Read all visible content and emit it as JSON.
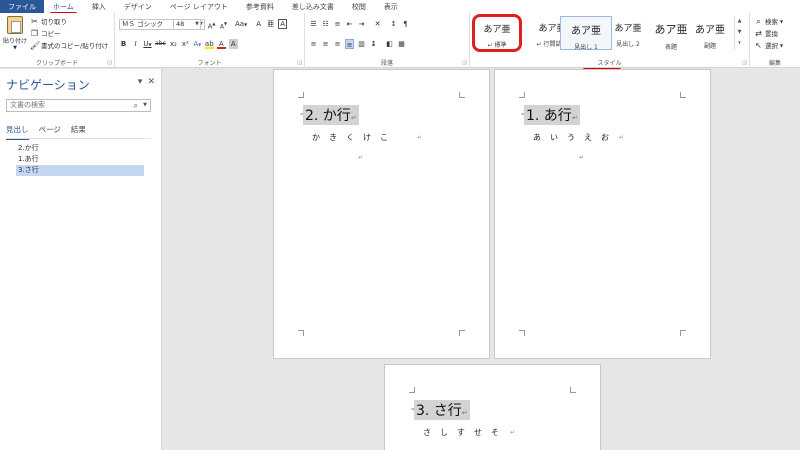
{
  "tabs": [
    "ファイル",
    "ホーム",
    "挿入",
    "デザイン",
    "ページ レイアウト",
    "参考資料",
    "差し込み文書",
    "校閲",
    "表示"
  ],
  "clipboard": {
    "label": "クリップボード",
    "paste": "貼り付け",
    "cut": "切り取り",
    "copy": "コピー",
    "format_painter": "書式のコピー/貼り付け"
  },
  "font": {
    "label": "フォント",
    "name": "ＭＳ ゴシック",
    "size": "48",
    "grow": "A",
    "shrink": "A",
    "case": "Aa",
    "clear": "A",
    "bold": "B",
    "italic": "I",
    "underline": "U",
    "strike": "abc",
    "sub": "x₂",
    "sup": "x²",
    "effects": "A",
    "highlight": "ab",
    "color": "A",
    "char_shade": "A",
    "char_border": "A",
    "phonetic": "亜"
  },
  "paragraph": {
    "label": "段落"
  },
  "styles": {
    "label": "スタイル",
    "items": [
      {
        "sample": "あア亜",
        "name": "↵ 標準"
      },
      {
        "sample": "あア亜",
        "name": "↵ 行間詰め"
      },
      {
        "sample": "あア亜",
        "name": "見出し 1"
      },
      {
        "sample": "あア亜",
        "name": "見出し 2"
      },
      {
        "sample": "あア亜",
        "name": "表題"
      },
      {
        "sample": "あア亜",
        "name": "副題"
      }
    ]
  },
  "editing": {
    "label": "編集",
    "find": "検索",
    "replace": "置換",
    "select": "選択"
  },
  "nav": {
    "title": "ナビゲーション",
    "search_placeholder": "文書の検索",
    "tabs": [
      "見出し",
      "ページ",
      "結果"
    ],
    "items": [
      "2.か行",
      "1.あ行",
      "3.さ行"
    ]
  },
  "pages": [
    {
      "heading": "2. か行",
      "line": "かきくけこ"
    },
    {
      "heading": "1. あ行",
      "line": "あいうえお"
    },
    {
      "heading": "3. さ行",
      "line": "さしすせそ"
    }
  ],
  "colors": {
    "accent": "#2b579a",
    "annotation": "#e0201f",
    "selected_nav": "#c5d7f0"
  }
}
